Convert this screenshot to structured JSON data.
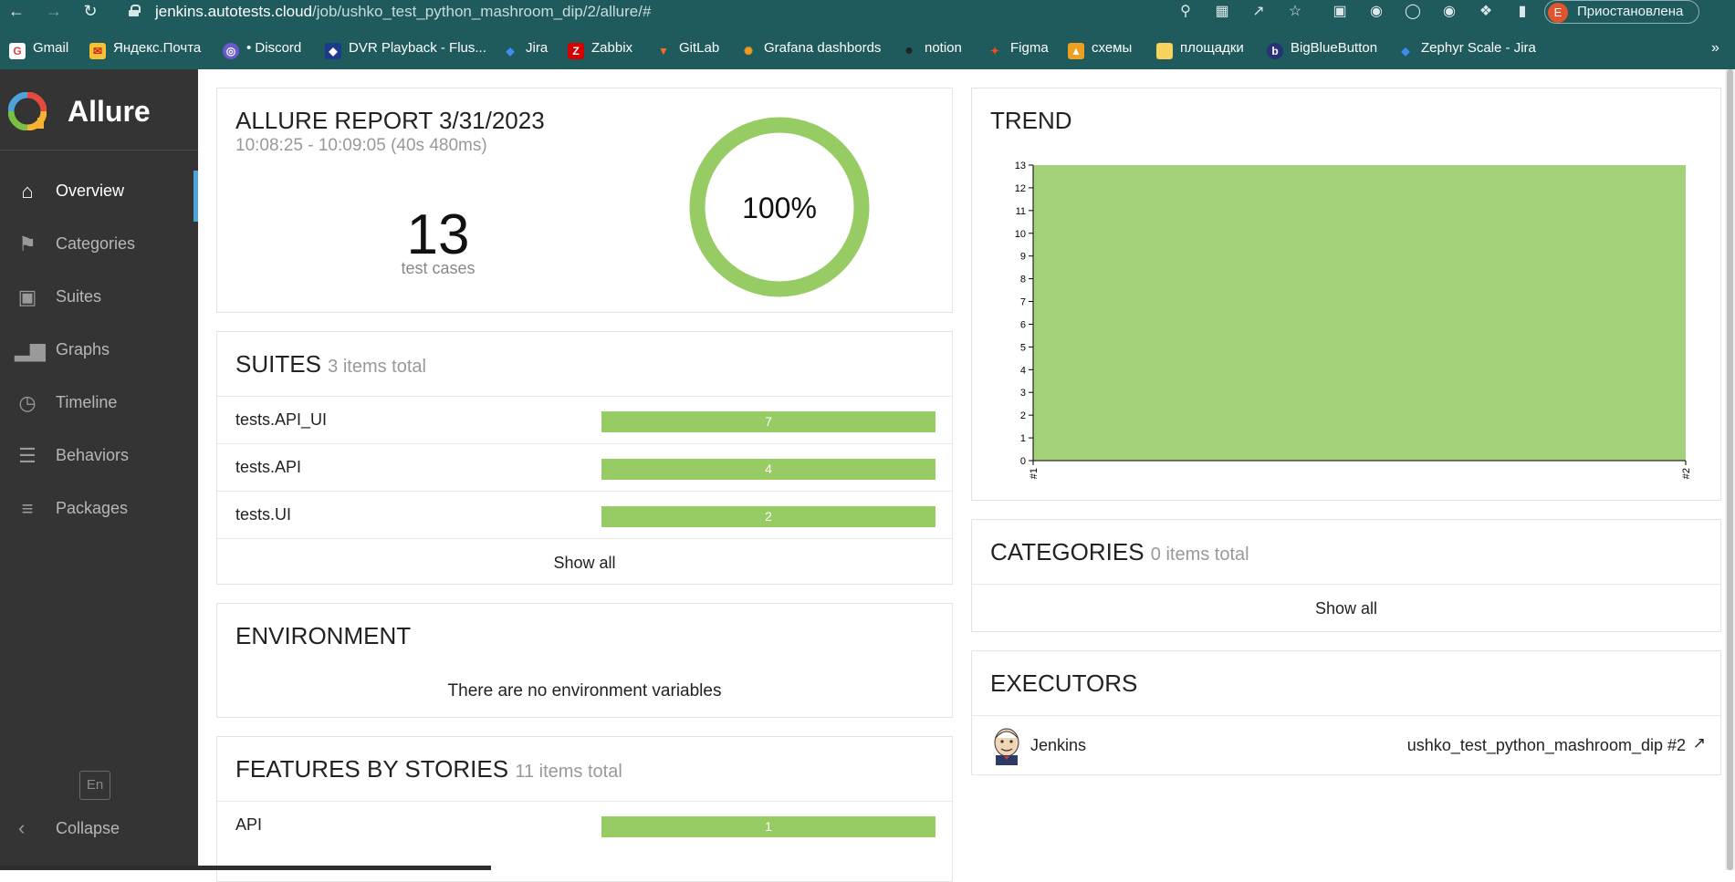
{
  "browser": {
    "url_host": "jenkins.autotests.cloud",
    "url_path": "/job/ushko_test_python_mashroom_dip/2/allure/#",
    "profile_initial": "E",
    "profile_label": "Приостановлена",
    "bookmarks": [
      "Gmail",
      "Яндекс.Почта",
      "• Discord",
      "DVR Playback - Flus...",
      "Jira",
      "Zabbix",
      "GitLab",
      "Grafana dashbords",
      "notion",
      "Figma",
      "схемы",
      "площадки",
      "BigBlueButton",
      "Zephyr Scale - Jira"
    ],
    "more": "»"
  },
  "sidebar": {
    "brand": "Allure",
    "items": [
      {
        "label": "Overview",
        "icon": "home-icon"
      },
      {
        "label": "Categories",
        "icon": "flag-icon"
      },
      {
        "label": "Suites",
        "icon": "briefcase-icon"
      },
      {
        "label": "Graphs",
        "icon": "bar-chart-icon"
      },
      {
        "label": "Timeline",
        "icon": "clock-icon"
      },
      {
        "label": "Behaviors",
        "icon": "list-icon"
      },
      {
        "label": "Packages",
        "icon": "align-left-icon"
      }
    ],
    "lang": "En",
    "collapse": "Collapse"
  },
  "report": {
    "title": "ALLURE REPORT 3/31/2023",
    "time": "10:08:25 - 10:09:05 (40s 480ms)",
    "count": "13",
    "count_label": "test cases",
    "percent": "100%",
    "pass_fraction": 1.0,
    "colors": {
      "passed": "#97cc64"
    }
  },
  "suites": {
    "title": "SUITES",
    "subtitle": "3 items total",
    "rows": [
      {
        "name": "tests.API_UI",
        "value": "7"
      },
      {
        "name": "tests.API",
        "value": "4"
      },
      {
        "name": "tests.UI",
        "value": "2"
      }
    ],
    "show_all": "Show all"
  },
  "environment": {
    "title": "ENVIRONMENT",
    "empty": "There are no environment variables"
  },
  "features": {
    "title": "FEATURES BY STORIES",
    "subtitle": "11 items total",
    "rows": [
      {
        "name": "API",
        "value": "1"
      }
    ]
  },
  "trend": {
    "title": "TREND"
  },
  "chart_data": {
    "type": "area",
    "x": [
      "#1",
      "#2"
    ],
    "series": [
      {
        "values": [
          13,
          13
        ],
        "color": "#a3d17a"
      }
    ],
    "ylim": [
      0,
      13
    ],
    "yticks": [
      "0",
      "1",
      "2",
      "3",
      "4",
      "5",
      "6",
      "7",
      "8",
      "9",
      "10",
      "11",
      "12",
      "13"
    ]
  },
  "categories": {
    "title": "CATEGORIES",
    "subtitle": "0 items total",
    "show_all": "Show all"
  },
  "executors": {
    "title": "EXECUTORS",
    "name": "Jenkins",
    "build": "ushko_test_python_mashroom_dip #2"
  }
}
